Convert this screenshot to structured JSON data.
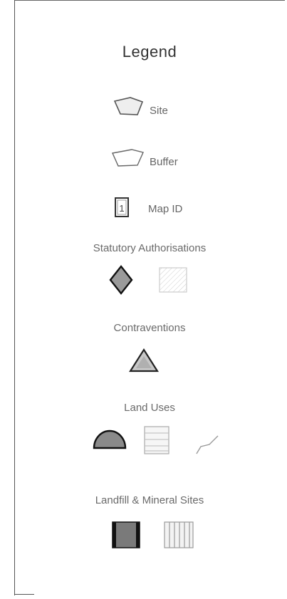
{
  "legend": {
    "title": "Legend",
    "items": {
      "site": "Site",
      "buffer": "Buffer",
      "map_id": "Map ID",
      "map_id_number": "1"
    },
    "sections": {
      "statutory": "Statutory Authorisations",
      "contraventions": "Contraventions",
      "land_uses": "Land Uses",
      "landfill": "Landfill & Mineral Sites"
    }
  },
  "colors": {
    "outline": "#444444",
    "site_fill": "#e8e8e8",
    "statutory_diamond": "#9a9a9a",
    "contravention_fill": "#bbbbbb",
    "land_use_fill": "#8a8a8a",
    "landfill_fill": "#7a7a7a"
  }
}
